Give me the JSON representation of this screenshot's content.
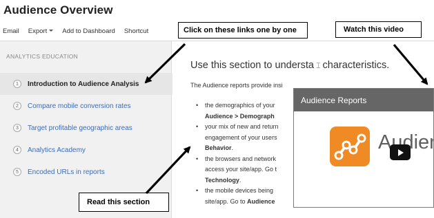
{
  "page": {
    "title": "Audience Overview"
  },
  "toolbar": {
    "email": "Email",
    "export": "Export",
    "add_to_dashboard": "Add to Dashboard",
    "shortcut": "Shortcut"
  },
  "sidebar": {
    "heading": "ANALYTICS EDUCATION",
    "items": [
      {
        "number": "1",
        "label": "Introduction to Audience Analysis",
        "active": true
      },
      {
        "number": "2",
        "label": "Compare mobile conversion rates",
        "active": false
      },
      {
        "number": "3",
        "label": "Target profitable geographic areas",
        "active": false
      },
      {
        "number": "4",
        "label": "Analytics Academy",
        "active": false
      },
      {
        "number": "5",
        "label": "Encoded URLs in reports",
        "active": false
      }
    ]
  },
  "main": {
    "heading": "Use this section to understa",
    "heading_tail": "characteristics.",
    "intro": "The Audience reports provide insi",
    "bullets": [
      {
        "line1": "the demographics of your",
        "line2_bold": "Audience > Demograph"
      },
      {
        "line1": "your mix of new and return",
        "line2": "engagement of your users",
        "line3_bold": "Behavior",
        "line3_tail": "."
      },
      {
        "line1": "the browsers and network",
        "line2": "access your site/app. Go t",
        "line3_bold": "Technology",
        "line3_tail": "."
      },
      {
        "line1": "the mobile devices being",
        "line2": "site/app. Go to ",
        "line2_bold": "Audience"
      }
    ]
  },
  "video": {
    "title": "Audience Reports",
    "brand_text": "Audien",
    "logo_color": "#f08a24",
    "play_icon": "play-icon"
  },
  "annotations": {
    "links": "Click on these links one by one",
    "video": "Watch this video",
    "read": "Read this section"
  },
  "colors": {
    "link": "#3c6db5",
    "sidebar_bg": "#f1f1f1",
    "video_titlebar": "#666666"
  }
}
